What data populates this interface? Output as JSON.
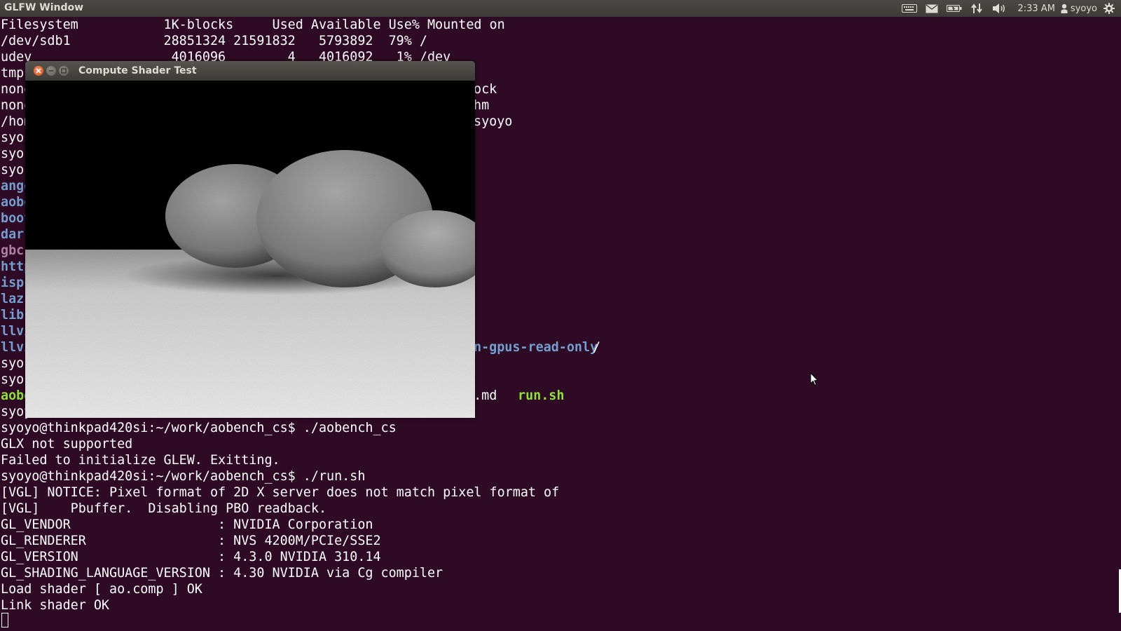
{
  "panel": {
    "title": "GLFW Window",
    "clock": "2:33 AM",
    "user": "syoyo",
    "indicators": [
      "keyboard-icon",
      "mail-icon",
      "battery-icon",
      "network-icon",
      "volume-icon",
      "gear-icon"
    ]
  },
  "terminal": {
    "lines": [
      "Filesystem           1K-blocks     Used Available Use% Mounted on",
      "/dev/sdb1            28851324 21591832   5793892  79% /",
      "udev                  4016096        4   4016092   1% /dev",
      "tmp",
      "none",
      "none",
      "/hom",
      "syo",
      "syo",
      "syo",
      "ange",
      "aobe",
      "boot",
      "dar",
      "gbc",
      "http",
      "ispc",
      "laz",
      "lib",
      "llvi",
      "llvi",
      "syo",
      "syo",
      "aobe",
      "syoy",
      "syoyo@thinkpad420si:~/work/aobench_cs$ ./aobench_cs",
      "GLX not supported",
      "Failed to initialize GLEW. Exitting.",
      "syoyo@thinkpad420si:~/work/aobench_cs$ ./run.sh",
      "[VGL] NOTICE: Pixel format of 2D X server does not match pixel format of",
      "[VGL]    Pbuffer.  Disabling PBO readback.",
      "GL_VENDOR                   : NVIDIA Corporation",
      "GL_RENDERER                 : NVS 4200M/PCIe/SSE2",
      "GL_VERSION                  : 4.3.0 NVIDIA 310.14",
      "GL_SHADING_LANGUAGE_VERSION : 4.30 NVIDIA via Cg compiler",
      "Load shader [ ao.comp ] OK",
      "Link shader OK"
    ],
    "fragments": {
      "lock": "ock",
      "shm": "hm",
      "home_user": "syoyo",
      "gpus_dir": "n-gpus-read-only",
      "gpus_slash": "/",
      "readme": "E.md",
      "run_sh": "run.sh"
    }
  },
  "compute_window": {
    "title": "Compute Shader Test"
  }
}
